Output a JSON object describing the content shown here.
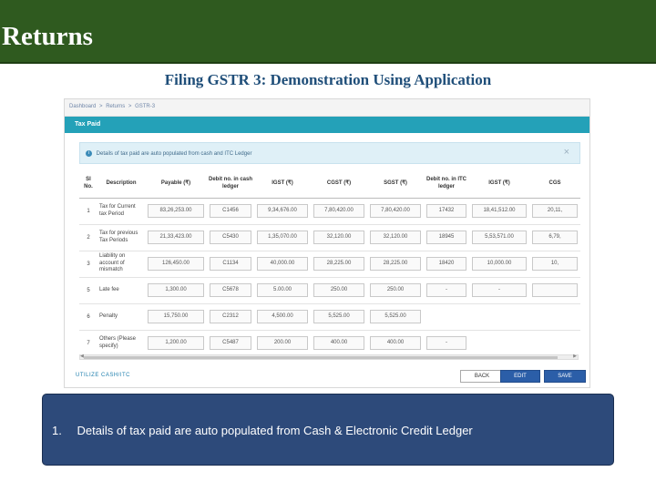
{
  "header": {
    "title": "Returns"
  },
  "subtitle": "Filing GSTR 3: Demonstration Using Application",
  "app": {
    "breadcrumb": [
      "Dashboard",
      ">",
      "Returns",
      ">",
      "GSTR-3"
    ],
    "panel_title": "Tax Paid",
    "info_text": "Details of tax paid are auto populated from cash and ITC Ledger",
    "columns": [
      "Sl No.",
      "Description",
      "Payable (₹)",
      "Debit no. in cash ledger",
      "IGST (₹)",
      "CGST (₹)",
      "SGST (₹)",
      "Debit no. in ITC ledger",
      "IGST (₹)",
      "CGS"
    ],
    "rows": [
      {
        "sl": "1",
        "description": "Tax for Current tax Period",
        "payable": "83,26,253.00",
        "debit_cash": "C1456",
        "igst": "9,34,676.00",
        "cgst": "7,80,420.00",
        "sgst": "7,80,420.00",
        "debit_itc": "17432",
        "igst2": "18,41,512.00",
        "cgst2": "20,11,"
      },
      {
        "sl": "2",
        "description": "Tax for previous Tax Periods",
        "payable": "21,33,423.00",
        "debit_cash": "C5430",
        "igst": "1,35,070.00",
        "cgst": "32,120.00",
        "sgst": "32,120.00",
        "debit_itc": "18945",
        "igst2": "5,53,571.00",
        "cgst2": "6,79,"
      },
      {
        "sl": "3",
        "description": "Liability on account of mismatch",
        "payable": "126,450.00",
        "debit_cash": "C1134",
        "igst": "40,000.00",
        "cgst": "28,225.00",
        "sgst": "28,225.00",
        "debit_itc": "18420",
        "igst2": "10,000.00",
        "cgst2": "10,"
      },
      {
        "sl": "5",
        "description": "Late fee",
        "payable": "1,300.00",
        "debit_cash": "C5678",
        "igst": "5.00.00",
        "cgst": "250.00",
        "sgst": "250.00",
        "debit_itc": "-",
        "igst2": "-",
        "cgst2": ""
      },
      {
        "sl": "6",
        "description": "Penalty",
        "payable": "15,750.00",
        "debit_cash": "C2312",
        "igst": "4,500.00",
        "cgst": "5,525.00",
        "sgst": "5,525.00",
        "debit_itc": "",
        "igst2": "",
        "cgst2": ""
      },
      {
        "sl": "7",
        "description": "Others (Please specify)",
        "payable": "1,200.00",
        "debit_cash": "C5487",
        "igst": "200.00",
        "cgst": "400.00",
        "sgst": "400.00",
        "debit_itc": "-",
        "igst2": "",
        "cgst2": ""
      }
    ],
    "utilize_link": "UTILIZE CASH/ITC",
    "buttons": {
      "back": "BACK",
      "edit": "EDIT",
      "save": "SAVE"
    }
  },
  "note": {
    "number": "1.",
    "text": "Details of tax paid are auto populated from Cash & Electronic Credit Ledger"
  }
}
